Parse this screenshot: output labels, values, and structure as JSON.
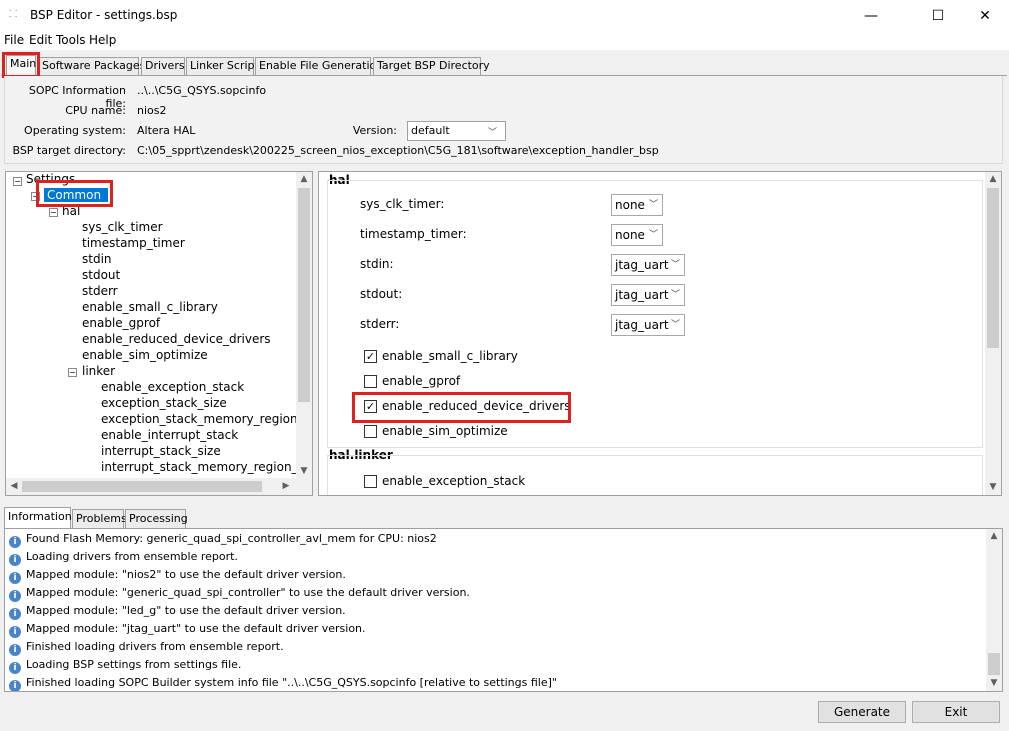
{
  "window": {
    "title": "BSP Editor - settings.bsp",
    "minimize": "—",
    "maximize": "☐",
    "close": "✕"
  },
  "menu": [
    "File",
    "Edit",
    "Tools",
    "Help"
  ],
  "tabs": [
    "Main",
    "Software Packages",
    "Drivers",
    "Linker Script",
    "Enable File Generation",
    "Target BSP Directory"
  ],
  "main": {
    "sopc_label": "SOPC Information file:",
    "sopc_value": "..\\..\\C5G_QSYS.sopcinfo",
    "cpu_label": "CPU name:",
    "cpu_value": "nios2",
    "os_label": "Operating system:",
    "os_value": "Altera HAL",
    "version_label": "Version:",
    "version_value": "default",
    "bsp_dir_label": "BSP target directory:",
    "bsp_dir_value": "C:\\05_spprt\\zendesk\\200225_screen_nios_exception\\C5G_181\\software\\exception_handler_bsp"
  },
  "tree": {
    "settings": "Settings",
    "common": "Common",
    "hal": "hal",
    "hal_children": [
      "sys_clk_timer",
      "timestamp_timer",
      "stdin",
      "stdout",
      "stderr",
      "enable_small_c_library",
      "enable_gprof",
      "enable_reduced_device_drivers",
      "enable_sim_optimize"
    ],
    "linker": "linker",
    "linker_children": [
      "enable_exception_stack",
      "exception_stack_size",
      "exception_stack_memory_region_na",
      "enable_interrupt_stack",
      "interrupt_stack_size",
      "interrupt_stack_memory_region_na"
    ]
  },
  "settings_panel": {
    "hal_header": "hal",
    "dropdowns": [
      {
        "label": "sys_clk_timer:",
        "value": "none"
      },
      {
        "label": "timestamp_timer:",
        "value": "none"
      },
      {
        "label": "stdin:",
        "value": "jtag_uart"
      },
      {
        "label": "stdout:",
        "value": "jtag_uart"
      },
      {
        "label": "stderr:",
        "value": "jtag_uart"
      }
    ],
    "checks": [
      {
        "label": "enable_small_c_library",
        "checked": true
      },
      {
        "label": "enable_gprof",
        "checked": false
      },
      {
        "label": "enable_reduced_device_drivers",
        "checked": true
      },
      {
        "label": "enable_sim_optimize",
        "checked": false
      }
    ],
    "linker_header": "hal.linker",
    "linker_checks": [
      {
        "label": "enable_exception_stack",
        "checked": false
      }
    ],
    "check_mark": "✓"
  },
  "bottom_tabs": [
    "Information",
    "Problems",
    "Processing"
  ],
  "log": [
    "Found Flash Memory: generic_quad_spi_controller_avl_mem for CPU: nios2",
    "Loading drivers from ensemble report.",
    "Mapped module: \"nios2\" to use the default driver version.",
    "Mapped module: \"generic_quad_spi_controller\" to use the default driver version.",
    "Mapped module: \"led_g\" to use the default driver version.",
    "Mapped module: \"jtag_uart\" to use the default driver version.",
    "Finished loading drivers from ensemble report.",
    "Loading BSP settings from settings file.",
    "Finished loading SOPC Builder system info file \"..\\..\\C5G_QSYS.sopcinfo [relative to settings file]\""
  ],
  "buttons": {
    "generate": "Generate",
    "exit": "Exit"
  },
  "colors": {
    "highlight": "#e02020",
    "selection": "#0078d7",
    "info_icon": "#4a84c8"
  }
}
